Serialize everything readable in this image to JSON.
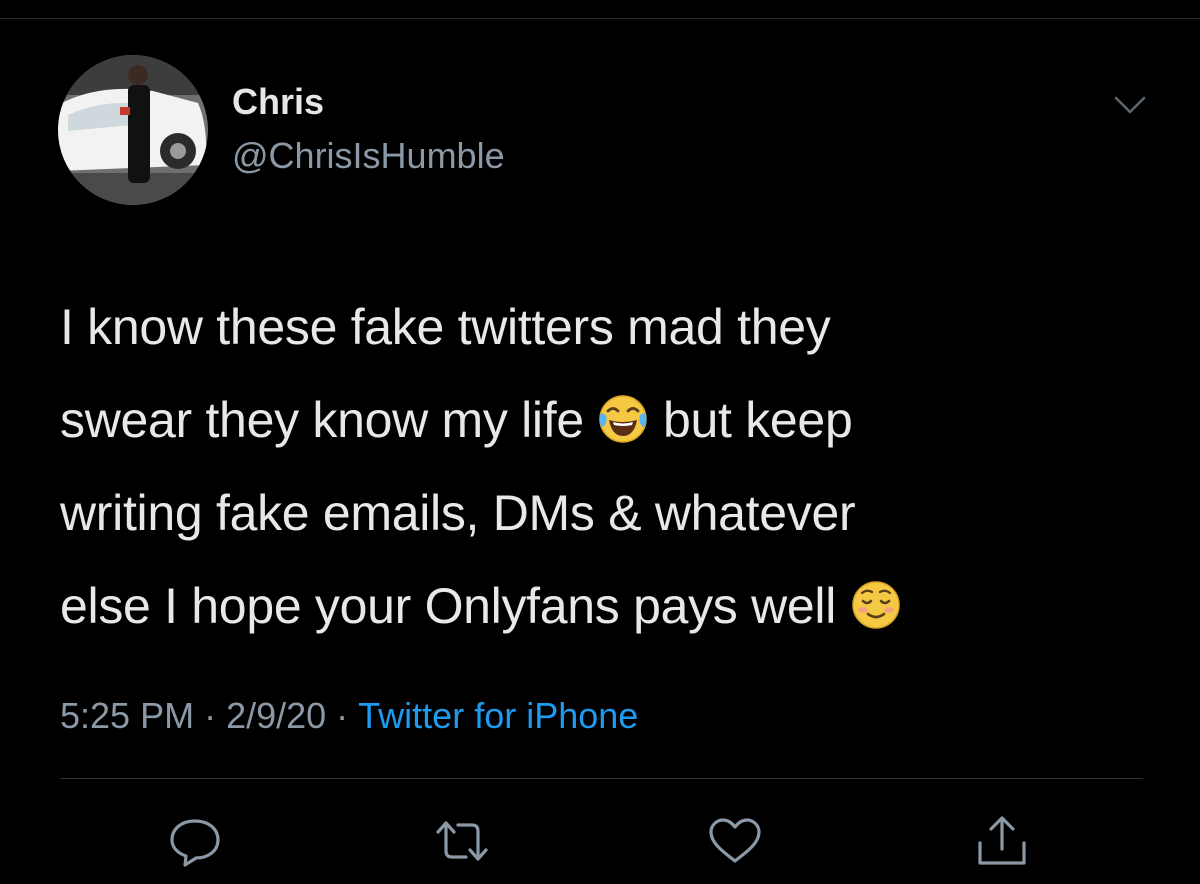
{
  "tweet": {
    "author": {
      "display_name": "Chris",
      "handle": "@ChrisIsHumble"
    },
    "text_lines": [
      {
        "before": "I know these fake twitters mad they",
        "emoji": "",
        "after": ""
      },
      {
        "before": "swear they know my life ",
        "emoji": "face-with-tears-of-joy",
        "after": " but keep"
      },
      {
        "before": "writing fake emails, DMs & whatever",
        "emoji": "",
        "after": ""
      },
      {
        "before": "else I hope your Onlyfans pays well ",
        "emoji": "smiling-face",
        "after": ""
      }
    ],
    "meta": {
      "time": "5:25 PM",
      "date": "2/9/20",
      "separator": "·",
      "source": "Twitter for iPhone"
    },
    "actions": [
      "reply-icon",
      "retweet-icon",
      "like-icon",
      "share-icon"
    ]
  },
  "colors": {
    "background": "#000000",
    "text": "#e8e8e8",
    "secondary_text": "#8b98a5",
    "link": "#1d9bf0",
    "icon": "#8b98a5",
    "divider": "#2f3336"
  }
}
